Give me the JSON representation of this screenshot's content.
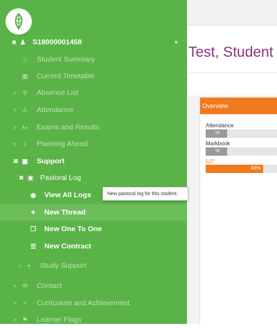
{
  "student": {
    "name": "Test, Student",
    "id": "S18000001458"
  },
  "overview": {
    "title": "Overview",
    "rows": [
      {
        "label": "Attendance",
        "value_text": "%",
        "fraction": 0.16
      },
      {
        "label": "Markbook",
        "value_text": "%",
        "fraction": 0.16
      },
      {
        "label": "ILP",
        "value_text": "43%",
        "fraction": 0.8
      }
    ]
  },
  "sidebar": {
    "items": [
      {
        "label": "Student Summary",
        "icon": "info-icon",
        "glyph": "ⓘ"
      },
      {
        "label": "Current Timetable",
        "icon": "calendar-icon",
        "glyph": "▦"
      },
      {
        "label": "Absence List",
        "icon": "person-icon",
        "glyph": "⚲"
      },
      {
        "label": "Attendance",
        "icon": "person-icon",
        "glyph": "♙"
      },
      {
        "label": "Exams and Results",
        "icon": "grade-icon",
        "glyph": "A+"
      },
      {
        "label": "Planning Ahead",
        "icon": "chart-icon",
        "glyph": "⊥"
      },
      {
        "label": "Support",
        "icon": "support-icon",
        "glyph": "▣"
      },
      {
        "label": "Pastoral Log",
        "icon": "log-icon",
        "glyph": "▣"
      },
      {
        "label": "View All Logs",
        "icon": "eye-icon",
        "glyph": "◉"
      },
      {
        "label": "New Thread",
        "icon": "plus-icon",
        "glyph": "+"
      },
      {
        "label": "New One To One",
        "icon": "copy-icon",
        "glyph": "❐"
      },
      {
        "label": "New Contract",
        "icon": "contract-icon",
        "glyph": "☰"
      },
      {
        "label": "Study Support",
        "icon": "pin-icon",
        "glyph": "♦"
      },
      {
        "label": "Contact",
        "icon": "mail-icon",
        "glyph": "✉"
      },
      {
        "label": "Curriculum and Achievement",
        "icon": "check-icon",
        "glyph": "✓"
      },
      {
        "label": "Learner Flags",
        "icon": "flag-icon",
        "glyph": "⚑"
      }
    ]
  },
  "tooltip": {
    "text": "New pastoral log for this student."
  },
  "colors": {
    "sidebar": "#5ab346",
    "accent": "#f07a1d",
    "name": "#8e2f7e"
  }
}
